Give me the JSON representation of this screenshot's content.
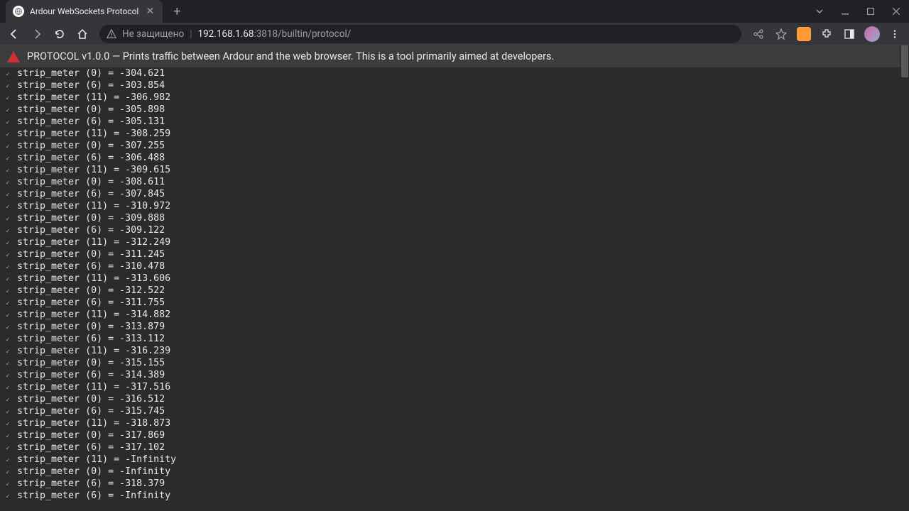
{
  "window": {
    "tab_title": "Ardour WebSockets Protocol"
  },
  "address": {
    "security_text": "Не защищено",
    "host": "192.168.1.68",
    "port_path": ":3818/builtin/protocol/"
  },
  "banner": {
    "text": "PROTOCOL v1.0.0 — Prints traffic between Ardour and the web browser. This is a tool primarily aimed at developers."
  },
  "log_lines": [
    "strip_meter (0) = -304.621",
    "strip_meter (6) = -303.854",
    "strip_meter (11) = -306.982",
    "strip_meter (0) = -305.898",
    "strip_meter (6) = -305.131",
    "strip_meter (11) = -308.259",
    "strip_meter (0) = -307.255",
    "strip_meter (6) = -306.488",
    "strip_meter (11) = -309.615",
    "strip_meter (0) = -308.611",
    "strip_meter (6) = -307.845",
    "strip_meter (11) = -310.972",
    "strip_meter (0) = -309.888",
    "strip_meter (6) = -309.122",
    "strip_meter (11) = -312.249",
    "strip_meter (0) = -311.245",
    "strip_meter (6) = -310.478",
    "strip_meter (11) = -313.606",
    "strip_meter (0) = -312.522",
    "strip_meter (6) = -311.755",
    "strip_meter (11) = -314.882",
    "strip_meter (0) = -313.879",
    "strip_meter (6) = -313.112",
    "strip_meter (11) = -316.239",
    "strip_meter (0) = -315.155",
    "strip_meter (6) = -314.389",
    "strip_meter (11) = -317.516",
    "strip_meter (0) = -316.512",
    "strip_meter (6) = -315.745",
    "strip_meter (11) = -318.873",
    "strip_meter (0) = -317.869",
    "strip_meter (6) = -317.102",
    "strip_meter (11) = -Infinity",
    "strip_meter (0) = -Infinity",
    "strip_meter (6) = -318.379",
    "strip_meter (6) = -Infinity"
  ]
}
